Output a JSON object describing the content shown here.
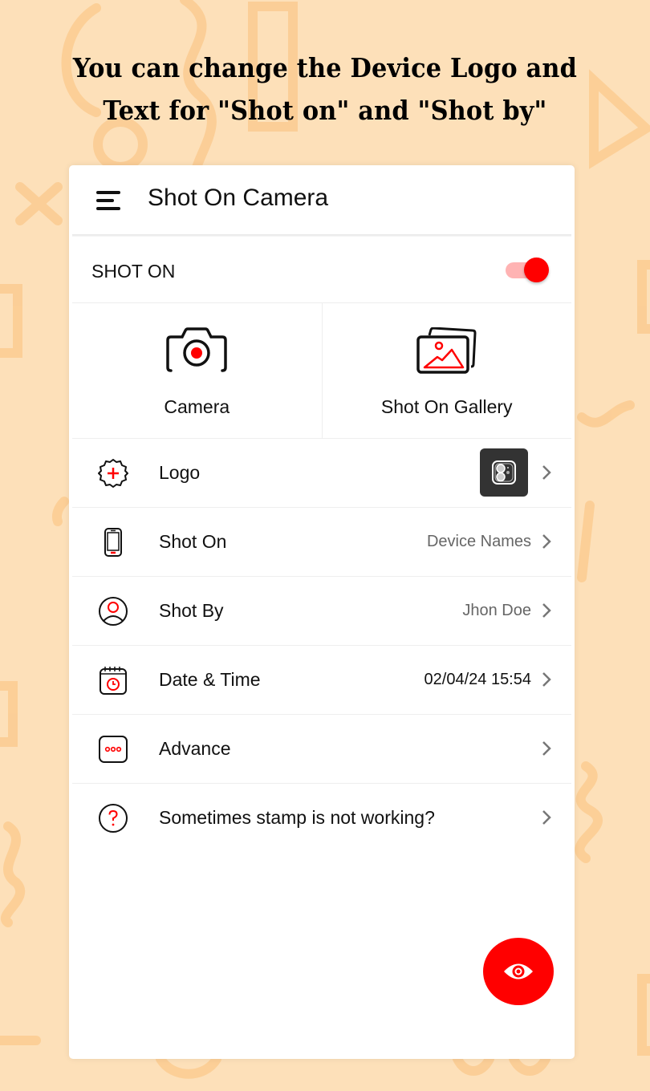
{
  "headline": {
    "line1": "You can change the Device Logo and",
    "line2": "Text for \"Shot on\" and \"Shot by\""
  },
  "appbar": {
    "title": "Shot On Camera",
    "menu_icon": "hamburger-menu-icon"
  },
  "shot_on_toggle": {
    "label": "SHOT ON",
    "enabled": true
  },
  "tiles": [
    {
      "label": "Camera",
      "icon": "camera-icon"
    },
    {
      "label": "Shot On Gallery",
      "icon": "gallery-icon"
    }
  ],
  "settings": [
    {
      "label": "Logo",
      "icon": "add-badge-icon",
      "value": "",
      "preview": "device-logo-thumbnail"
    },
    {
      "label": "Shot On",
      "icon": "phone-icon",
      "value": "Device Names"
    },
    {
      "label": "Shot By",
      "icon": "user-icon",
      "value": "Jhon Doe"
    },
    {
      "label": "Date & Time",
      "icon": "calendar-clock-icon",
      "value": "02/04/24 15:54"
    },
    {
      "label": "Advance",
      "icon": "more-dots-icon",
      "value": ""
    },
    {
      "label": "Sometimes stamp is not working?",
      "icon": "help-icon",
      "value": ""
    }
  ],
  "fab": {
    "icon": "eye-icon",
    "action": "preview"
  },
  "colors": {
    "accent": "#ff0000",
    "background": "#fde0b9",
    "card": "#ffffff",
    "text": "#111111",
    "secondary_text": "#666666"
  }
}
